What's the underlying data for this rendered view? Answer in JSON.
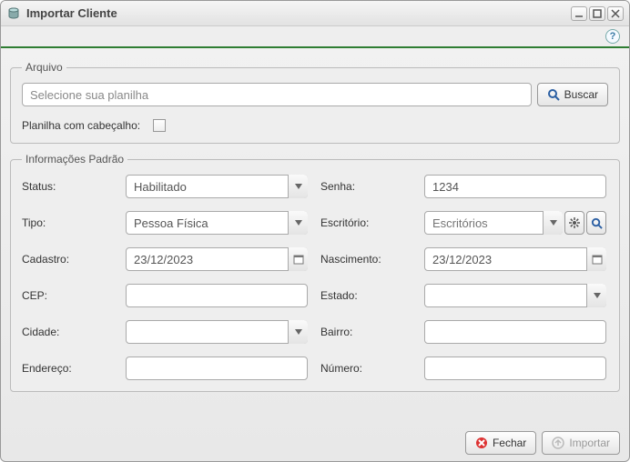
{
  "window": {
    "title": "Importar Cliente"
  },
  "fieldset_arquivo": {
    "legend": "Arquivo",
    "file_placeholder": "Selecione sua planilha",
    "buscar_label": "Buscar",
    "header_checkbox_label": "Planilha com cabeçalho:"
  },
  "fieldset_info": {
    "legend": "Informações Padrão",
    "labels": {
      "status": "Status:",
      "senha": "Senha:",
      "tipo": "Tipo:",
      "escritorio": "Escritório:",
      "cadastro": "Cadastro:",
      "nascimento": "Nascimento:",
      "cep": "CEP:",
      "estado": "Estado:",
      "cidade": "Cidade:",
      "bairro": "Bairro:",
      "endereco": "Endereço:",
      "numero": "Número:"
    },
    "values": {
      "status": "Habilitado",
      "senha": "1234",
      "tipo": "Pessoa Física",
      "escritorio_placeholder": "Escritórios",
      "cadastro": "23/12/2023",
      "nascimento": "23/12/2023",
      "cep": "",
      "estado": "",
      "cidade": "",
      "bairro": "",
      "endereco": "",
      "numero": ""
    }
  },
  "footer": {
    "fechar_label": "Fechar",
    "importar_label": "Importar"
  }
}
